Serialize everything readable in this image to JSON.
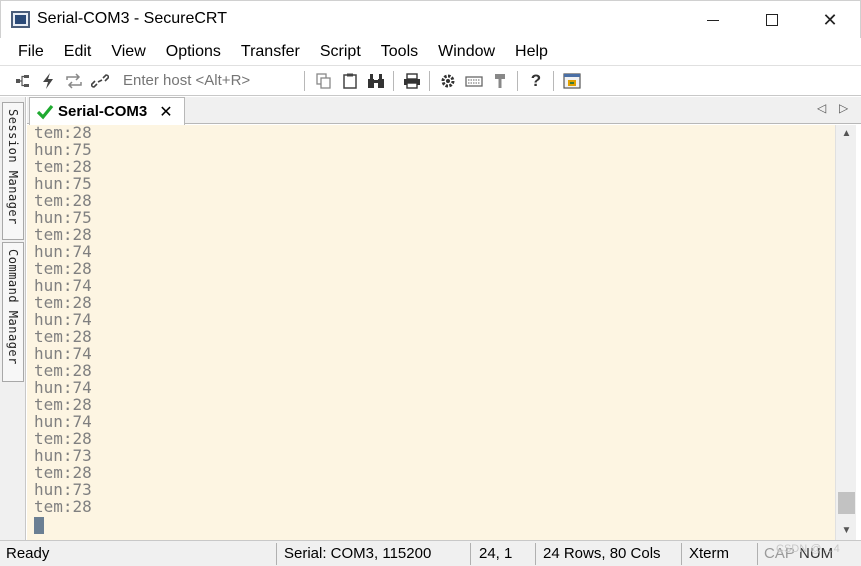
{
  "window": {
    "title": "Serial-COM3 - SecureCRT"
  },
  "menu": {
    "items": [
      "File",
      "Edit",
      "View",
      "Options",
      "Transfer",
      "Script",
      "Tools",
      "Window",
      "Help"
    ]
  },
  "toolbar": {
    "host_placeholder": "Enter host <Alt+R>",
    "icons": [
      "connect-icon",
      "quick-connect-icon",
      "reconnect-icon",
      "disconnect-icon",
      "copy-icon",
      "paste-icon",
      "find-icon",
      "print-icon",
      "session-options-icon",
      "keymap-icon",
      "sftp-icon",
      "help-icon",
      "screenshot-icon"
    ]
  },
  "side_dock": {
    "session_manager": "Session Manager",
    "command_manager": "Command Manager"
  },
  "tabs": [
    {
      "label": "Serial-COM3",
      "status": "connected"
    }
  ],
  "terminal": {
    "lines": [
      "tem:28",
      "hun:75",
      "tem:28",
      "hun:75",
      "tem:28",
      "hun:75",
      "tem:28",
      "hun:74",
      "tem:28",
      "hun:74",
      "tem:28",
      "hun:74",
      "tem:28",
      "hun:74",
      "tem:28",
      "hun:74",
      "tem:28",
      "hun:74",
      "tem:28",
      "hun:73",
      "tem:28",
      "hun:73",
      "tem:28"
    ],
    "background": "#fdf5e2",
    "foreground": "#808080"
  },
  "statusbar": {
    "ready": "Ready",
    "connection": "Serial: COM3, 115200",
    "cursor_pos": "24,  1",
    "size": "24 Rows, 80 Cols",
    "emulation": "Xterm",
    "caps": "CAP",
    "num": "NUM"
  },
  "watermark": "CSDN @ ...4"
}
